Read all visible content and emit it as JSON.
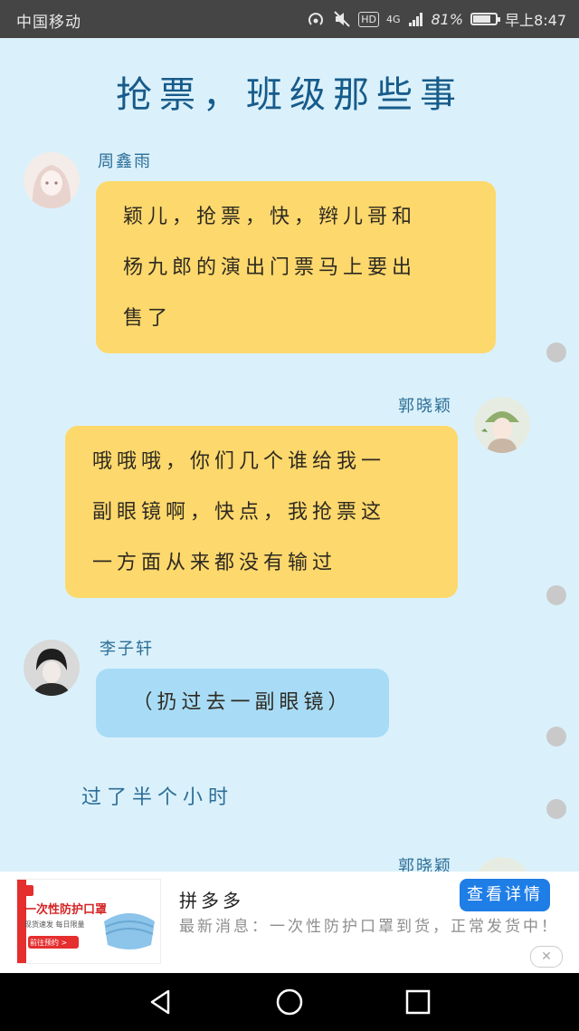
{
  "status_bar": {
    "carrier": "中国移动",
    "network_badge": "HD",
    "network_type": "4G",
    "battery": "81%",
    "battery_level": 0.81,
    "time": "早上8:47"
  },
  "chat": {
    "title": "抢票，班级那些事",
    "messages": [
      {
        "sender": "周鑫雨",
        "side": "left",
        "bubble_color": "#fdd86c",
        "lines": [
          "颖儿，抢票，快，辫儿哥和",
          "杨九郎的演出门票马上要出",
          "售了"
        ]
      },
      {
        "sender": "郭晓颖",
        "side": "right",
        "bubble_color": "#fdd86c",
        "lines": [
          "哦哦哦，你们几个谁给我一",
          "副眼镜啊，快点，我抢票这",
          "一方面从来都没有输过"
        ]
      },
      {
        "sender": "李子轩",
        "side": "left",
        "bubble_color": "#a8dcf6",
        "lines": [
          "（扔过去一副眼镜）"
        ]
      }
    ],
    "narration": "过了半个小时",
    "partial_sender": "郭晓颖"
  },
  "ad": {
    "thumb_title": "一次性防护口罩",
    "thumb_sub": "现货速发 每日限量",
    "thumb_button": "前往预约 >",
    "name": "拼多多",
    "description": "最新消息：一次性防护口罩到货，正常发货中！",
    "button": "查看详情",
    "close_symbol": "✕"
  },
  "colors": {
    "chat_bg": "#daf1fb",
    "title": "#175b8a",
    "yellow_bubble": "#fdd86c",
    "blue_bubble": "#a8dcf6",
    "ad_button": "#1f7de6"
  },
  "icons": [
    "hotspot-icon",
    "mute-icon",
    "signal-icon",
    "battery-icon",
    "back-icon",
    "home-icon",
    "recents-icon",
    "close-icon"
  ]
}
